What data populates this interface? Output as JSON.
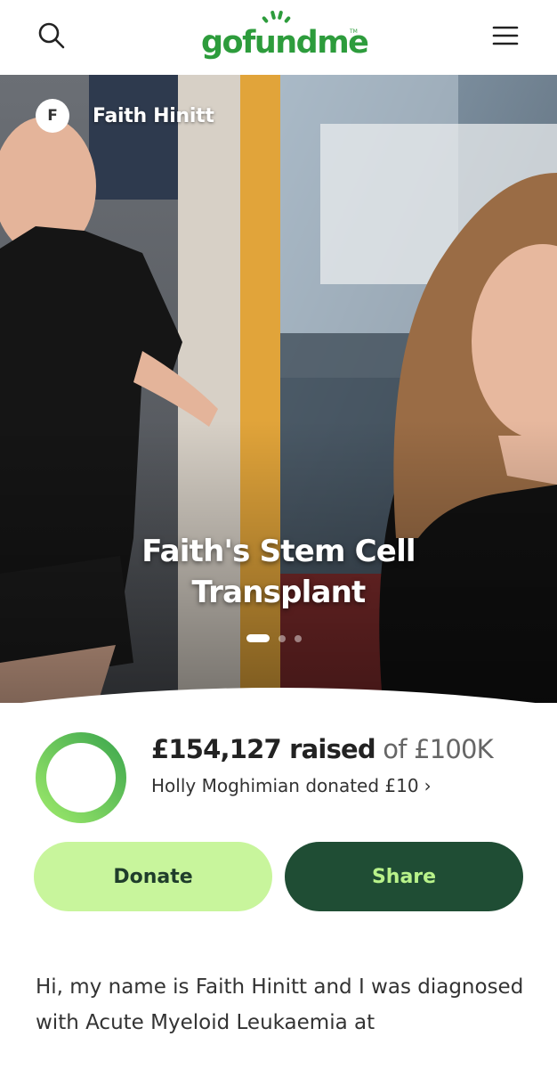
{
  "header": {
    "logo_text": "gofundme",
    "logo_tm": "TM",
    "search_icon": "search-icon",
    "menu_icon": "hamburger-menu-icon",
    "brand_color": "#2d9c3c"
  },
  "hero": {
    "organizer_initial": "F",
    "organizer_name": "Faith Hinitt",
    "title_line1": "Faith's Stem Cell",
    "title_line2": "Transplant",
    "slides": 3,
    "active_slide": 1
  },
  "progress": {
    "raised_amount": "£154,127 raised",
    "goal_text": "of £100K",
    "recent_donation": "Holly Moghimian donated £10",
    "ring_fraction": 1.0,
    "ring_color": "#7ed957"
  },
  "actions": {
    "donate_label": "Donate",
    "share_label": "Share",
    "donate_color": "#c8f59c",
    "share_color": "#1f4d34"
  },
  "story": {
    "text": "Hi, my name is Faith Hinitt and I was diagnosed with Acute Myeloid Leukaemia at"
  }
}
